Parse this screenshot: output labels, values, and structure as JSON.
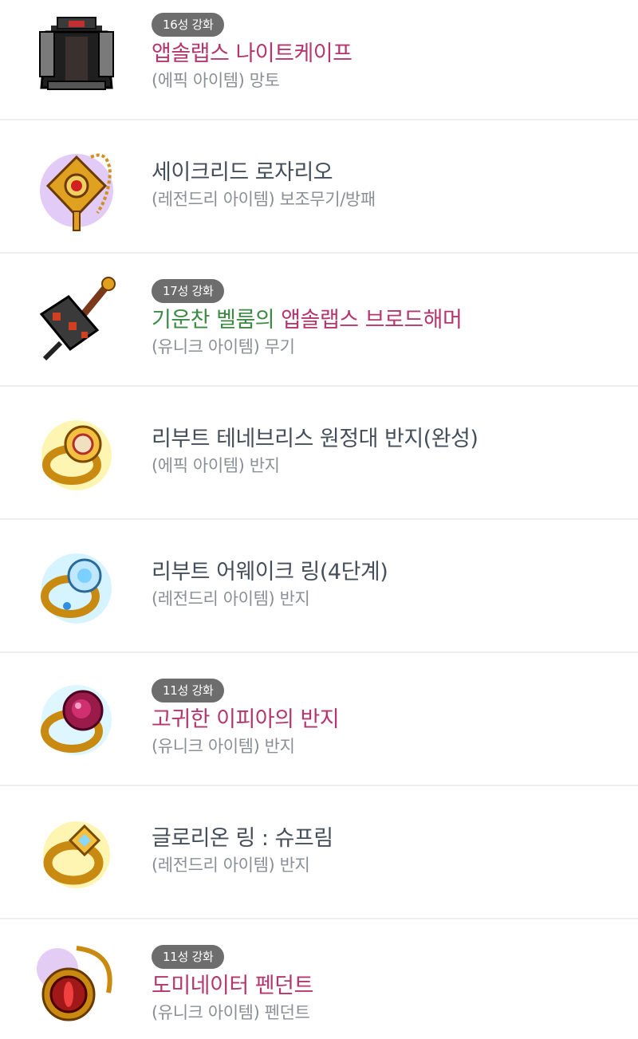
{
  "items": [
    {
      "badge": "16성 강화",
      "name_parts": [
        {
          "text": "앱솔랩스 나이트케이프",
          "color": "pink"
        }
      ],
      "subtitle": "(에픽 아이템) 망토",
      "icon": "cape-icon"
    },
    {
      "badge": "",
      "name_parts": [
        {
          "text": "세이크리드 로자리오",
          "color": "gray"
        }
      ],
      "subtitle": "(레전드리 아이템) 보조무기/방패",
      "icon": "rosary-icon"
    },
    {
      "badge": "17성 강화",
      "name_parts": [
        {
          "text": "기운찬 벨룸의 ",
          "color": "green"
        },
        {
          "text": "앱솔랩스 브로드해머",
          "color": "pink"
        }
      ],
      "subtitle": "(유니크 아이템) 무기",
      "icon": "hammer-icon"
    },
    {
      "badge": "",
      "name_parts": [
        {
          "text": "리부트 테네브리스 원정대 반지(완성)",
          "color": "gray"
        }
      ],
      "subtitle": "(에픽 아이템) 반지",
      "icon": "ring-icon"
    },
    {
      "badge": "",
      "name_parts": [
        {
          "text": "리부트 어웨이크 링(4단계)",
          "color": "gray"
        }
      ],
      "subtitle": "(레전드리 아이템) 반지",
      "icon": "ring-icon"
    },
    {
      "badge": "11성 강화",
      "name_parts": [
        {
          "text": "고귀한 이피아의 반지",
          "color": "pink"
        }
      ],
      "subtitle": "(유니크 아이템) 반지",
      "icon": "ring-icon"
    },
    {
      "badge": "",
      "name_parts": [
        {
          "text": "글로리온 링 : 슈프림",
          "color": "gray"
        }
      ],
      "subtitle": "(레전드리 아이템) 반지",
      "icon": "ring-icon"
    },
    {
      "badge": "11성 강화",
      "name_parts": [
        {
          "text": "도미네이터 펜던트",
          "color": "pink"
        }
      ],
      "subtitle": "(유니크 아이템) 펜던트",
      "icon": "pendant-icon"
    }
  ],
  "colors": {
    "pink": "#b5366e",
    "green": "#3d8a45",
    "gray": "#454f5b",
    "badge_bg": "#6d6d6d",
    "divider": "#eeeeee"
  }
}
